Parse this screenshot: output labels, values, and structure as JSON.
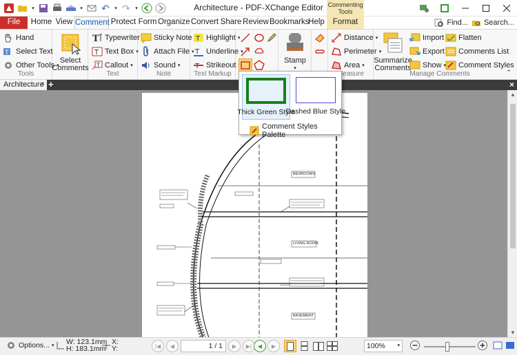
{
  "app": {
    "title": "Architecture - PDF-XChange Editor",
    "context_tab_title": "Commenting Tools"
  },
  "tabs": {
    "file": "File",
    "home": "Home",
    "view": "View",
    "comment": "Comment",
    "protect": "Protect",
    "form": "Form",
    "organize": "Organize",
    "convert": "Convert",
    "share": "Share",
    "review": "Review",
    "bookmarks": "Bookmarks",
    "help": "Help",
    "format": "Format"
  },
  "toolbar_right": {
    "find": "Find...",
    "search": "Search..."
  },
  "ribbon": {
    "tools": {
      "label": "Tools",
      "hand": "Hand",
      "select_text": "Select Text",
      "other_tools": "Other Tools"
    },
    "select_comments": {
      "line1": "Select",
      "line2": "Comments"
    },
    "text": {
      "label": "Text",
      "typewriter": "Typewriter",
      "text_box": "Text Box",
      "callout": "Callout"
    },
    "note": {
      "label": "Note",
      "sticky_note": "Sticky Note",
      "attach_file": "Attach File",
      "sound": "Sound"
    },
    "text_markup": {
      "label": "Text Markup",
      "highlight": "Highlight",
      "underline": "Underline",
      "strikeout": "Strikeout"
    },
    "stamp": "Stamp",
    "measure": {
      "label": "Measure",
      "distance": "Distance",
      "perimeter": "Perimeter",
      "area": "Area"
    },
    "manage": {
      "label": "Manage Comments",
      "summarize1": "Summarize",
      "summarize2": "Comments",
      "import": "Import",
      "export": "Export",
      "show": "Show",
      "flatten": "Flatten",
      "comments_list": "Comments List",
      "comment_styles": "Comment Styles"
    }
  },
  "doc": {
    "tab": "Architecture",
    "labels": {
      "bedrooms": "BEDROOMS",
      "living_room": "LIVING ROOM",
      "basement": "BASEMENT"
    }
  },
  "dropdown": {
    "thick_green": "Thick Green Style",
    "dashed_blue": "Dashed Blue Style",
    "palette": "Comment Styles Palette"
  },
  "status": {
    "options": "Options...",
    "width": "W: 123.1mm",
    "height": "H: 183.1mm",
    "x": "X:",
    "y": "Y:",
    "page": "1 / 1",
    "zoom": "100%"
  },
  "colors": {
    "file_tab": "#c9302c",
    "context_tab": "#f6e6b4",
    "thick_green": "#1a7f1a",
    "dashed_blue": "#4a4ad6"
  }
}
